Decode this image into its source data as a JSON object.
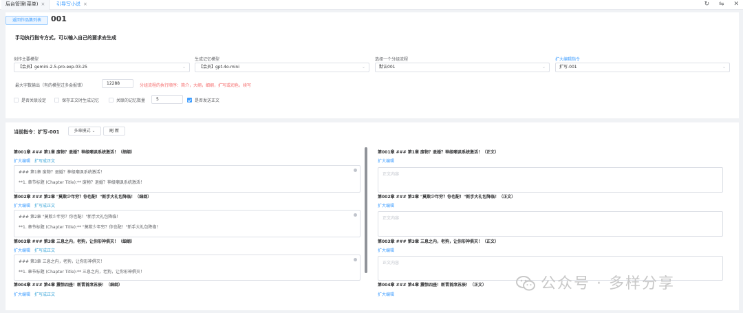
{
  "tabs": [
    {
      "label": "后台管理(菜单)",
      "close": "×"
    },
    {
      "label": "引导写小说",
      "close": "×"
    }
  ],
  "top_icons": [
    "refresh-icon",
    "swap-icon",
    "close-icon"
  ],
  "top_icon_glyphs": {
    "refresh": "↻",
    "swap": "⇋",
    "close": "✕"
  },
  "header": {
    "back_label": "返回作品集列表",
    "title": "001"
  },
  "description": "手动执行指令方式，可以输入自己的要求去生成",
  "form": {
    "main_model_label": "创作主要模型",
    "main_model_value": "【会员】gemini-2.5-pro-exp-03-25",
    "memory_model_label": "生成记忆模型",
    "memory_model_value": "【会员】gpt-4o-mini",
    "flow_label": "选择一个分组流程",
    "flow_value": "默认001",
    "instruction_label": "扩大编辑指令",
    "instruction_value": "扩写-001",
    "max_words_label": "最大字数输出（有的模型过多会报错）",
    "max_words_value": "12288",
    "flow_order_text": "分组流程的执行顺序：简介，大纲，细纲，扩写或润色，续写",
    "caret": "⌄",
    "checkboxes": [
      {
        "label": "是否关联设定",
        "checked": false
      },
      {
        "label": "保存正文时生成记忆",
        "checked": false
      },
      {
        "label": "关联的记忆数量",
        "checked": false
      },
      {
        "label": "是否发送正文",
        "checked": true
      }
    ],
    "memory_count_value": "5"
  },
  "current": {
    "label": "当前指令：扩写-001",
    "mode": "多章模式",
    "refresh": "刷 新"
  },
  "left_chapters": [
    {
      "title": "第001章 ### 第1章 废物？退婚？神级嘲讽系统激活！（细纲）",
      "links": [
        "扩大编辑",
        "扩写成正文"
      ],
      "line1": "### 第1章 废物？退婚？神级嘲讽系统激活！",
      "line2": "**1. 章节标题 (Chapter Title):** 废物？退婚？神级嘲讽系统激活！"
    },
    {
      "title": "第002章 ### 第2章 \"莫欺少年穷？你也配！\"新手大礼包降临！（细纲）",
      "links": [
        "扩大编辑",
        "扩写成正文"
      ],
      "line1": "### 第2章 \"莫欺少年穷？你也配！\"新手大礼包降临！",
      "line2": "**1. 章节标题 (Chapter Title):** \"莫欺少年穷？你也配！\"新手大礼包降临！"
    },
    {
      "title": "第003章 ### 第3章 三息之内，老狗，让你形神俱灭！（细纲）",
      "links": [
        "扩大编辑",
        "扩写成正文"
      ],
      "line1": "### 第3章 三息之内，老狗，让你形神俱灭！",
      "line2": "**1. 章节标题 (Chapter Title):** 三息之内，老狗，让你形神俱灭！"
    },
    {
      "title": "第004章 ### 第4章 震惊四座！新晋首席苏辰！（细纲）",
      "links": [
        "扩大编辑",
        "扩写成正文"
      ]
    }
  ],
  "right_chapters": [
    {
      "title": "第001章 ### 第1章 废物？退婚？神级嘲讽系统激活！（正文）",
      "link": "扩大编辑",
      "placeholder": "正文内容"
    },
    {
      "title": "第002章 ### 第2章 \"莫欺少年穷？你也配！\"新手大礼包降临！（正文）",
      "link": "扩大编辑",
      "placeholder": "正文内容"
    },
    {
      "title": "第003章 ### 第3章 三息之内，老狗，让你形神俱灭！（正文）",
      "link": "扩大编辑",
      "placeholder": "正文内容"
    },
    {
      "title": "第004章 ### 第4章 震惊四座！新晋首席苏辰！（正文）",
      "link": "扩大编辑"
    }
  ],
  "watermark": "公众号 · 多样分享"
}
